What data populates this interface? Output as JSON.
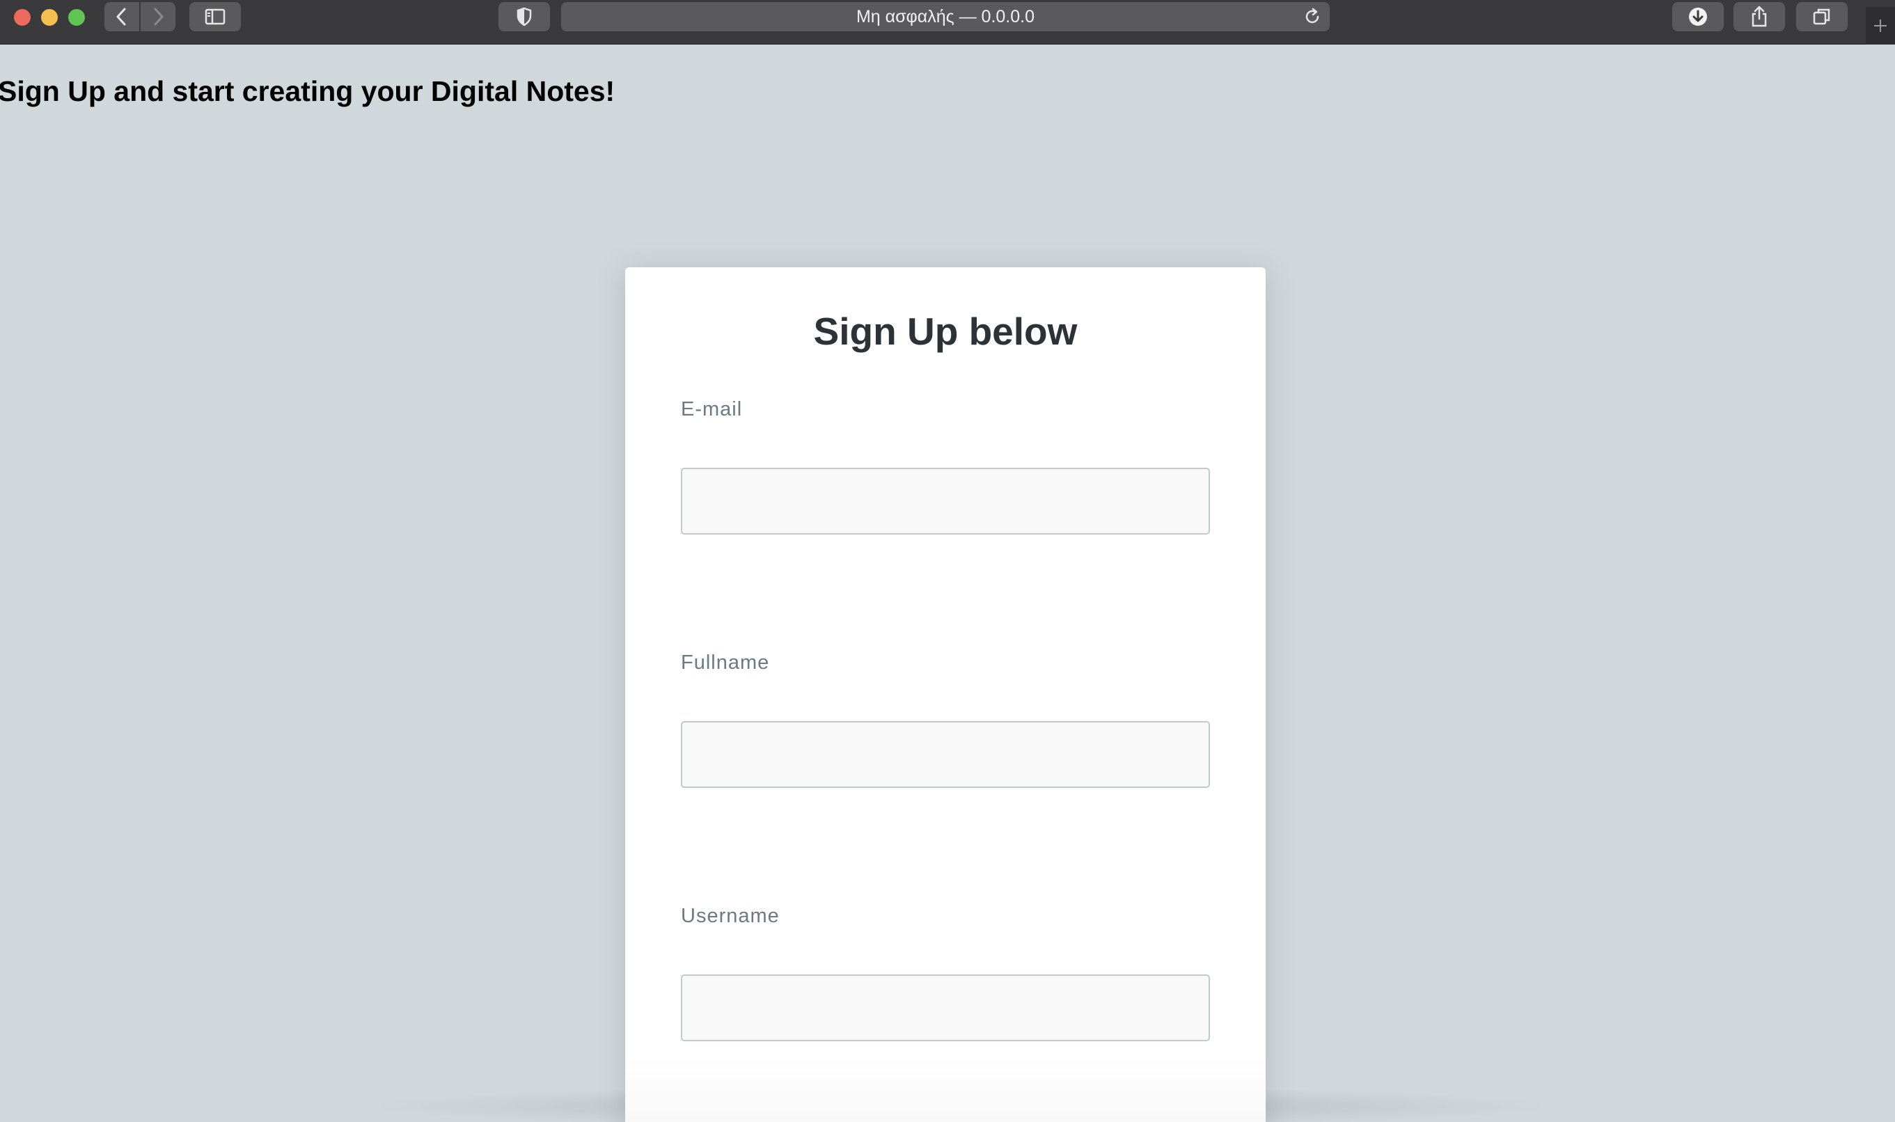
{
  "browser": {
    "address": "Μη ασφαλής — 0.0.0.0",
    "icons": {
      "back": "chevron-left-icon",
      "forward": "chevron-right-icon",
      "sidebar": "sidebar-icon",
      "privacy": "shield-icon",
      "reload": "reload-icon",
      "download": "download-icon",
      "share": "share-icon",
      "tabs": "tabs-overview-icon",
      "new_tab": "plus-icon"
    }
  },
  "page": {
    "heading": "Sign Up and start creating your Digital Notes!",
    "background_color": "#d1d8dc"
  },
  "form": {
    "title": "Sign Up below",
    "fields": [
      {
        "label": "E-mail",
        "value": "",
        "placeholder": ""
      },
      {
        "label": "Fullname",
        "value": "",
        "placeholder": ""
      },
      {
        "label": "Username",
        "value": "",
        "placeholder": ""
      }
    ]
  }
}
